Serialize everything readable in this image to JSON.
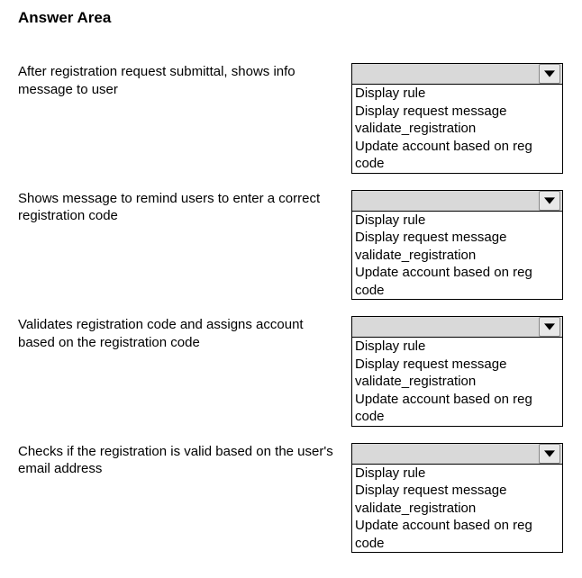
{
  "title": "Answer Area",
  "options": [
    "Display rule",
    "Display request message",
    "validate_registration",
    "Update account based on reg code"
  ],
  "rows": [
    {
      "prompt": "After registration request submittal, shows info message to user"
    },
    {
      "prompt": "Shows message to remind users to enter a correct registration code"
    },
    {
      "prompt": "Validates registration code and assigns account based on the registration code"
    },
    {
      "prompt": "Checks if the registration is valid based on the user's email address"
    }
  ]
}
